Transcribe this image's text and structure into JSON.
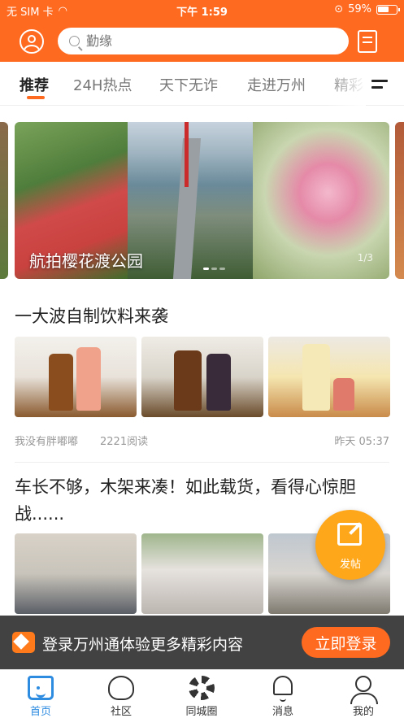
{
  "status_bar": {
    "carrier": "无 SIM 卡",
    "time": "下午 1:59",
    "battery": "59%"
  },
  "header": {
    "search_placeholder": "勤缘"
  },
  "tabs": [
    "推荐",
    "24H热点",
    "天下无诈",
    "走进万州",
    "精彩"
  ],
  "banner": {
    "caption": "航拍樱花渡公园",
    "counter": "1/3"
  },
  "articles": [
    {
      "title": "一大波自制饮料来袭",
      "author": "我没有胖嘟嘟",
      "reads": "2221阅读",
      "date": "昨天 05:37"
    },
    {
      "title": "车长不够，木架来凑！如此载货，看得心惊胆战......"
    }
  ],
  "fab": {
    "label": "发帖"
  },
  "login_bar": {
    "message": "登录万州通体验更多精彩内容",
    "button": "立即登录"
  },
  "tabbar": [
    "首页",
    "社区",
    "同城圈",
    "消息",
    "我的"
  ],
  "colors": {
    "brand": "#ff6a21",
    "fab": "#ffa71a",
    "active_tab": "#2d8be0"
  }
}
